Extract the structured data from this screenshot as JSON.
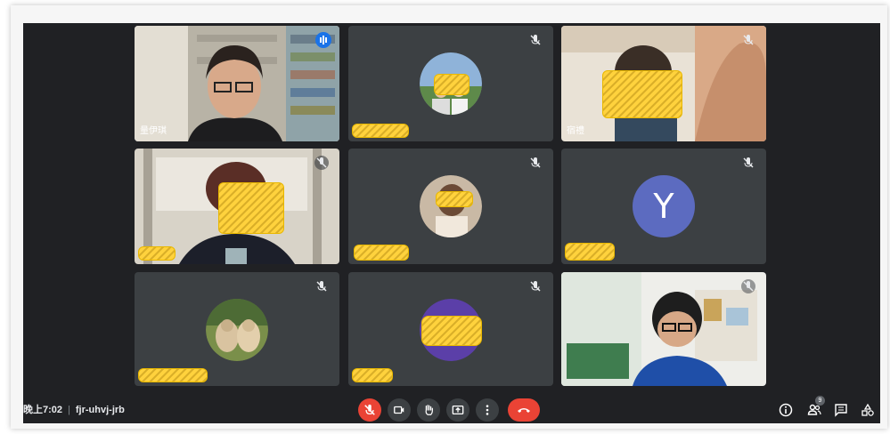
{
  "meeting": {
    "time": "晚上7:02",
    "separator": "|",
    "code": "fjr-uhvj-jrb"
  },
  "tiles": [
    {
      "name": "量伊琪",
      "state": "speaking"
    },
    {
      "name": "",
      "state": "muted"
    },
    {
      "name": "宿禮",
      "state": "muted"
    },
    {
      "name": "",
      "state": "muted"
    },
    {
      "name": "",
      "state": "muted"
    },
    {
      "name": "",
      "state": "muted",
      "avatar_letter": "Y"
    },
    {
      "name": "",
      "state": "muted"
    },
    {
      "name": "",
      "state": "muted"
    },
    {
      "name": "",
      "state": "muted"
    }
  ],
  "controls": {
    "mic": "mic-off-icon",
    "camera": "camera-icon",
    "raise_hand": "hand-icon",
    "present": "present-screen-icon",
    "more": "more-vert-icon",
    "end_call": "end-call-icon"
  },
  "side_controls": {
    "info": "info-icon",
    "people": "people-icon",
    "people_count": "9",
    "chat": "chat-icon",
    "activities": "activities-icon"
  },
  "colors": {
    "background": "#202124",
    "tile": "#3c4043",
    "accent": "#8ab4f8",
    "end_call": "#ea4335",
    "redaction": "#ffd23d",
    "letter_avatar": "#5c6bc0"
  }
}
